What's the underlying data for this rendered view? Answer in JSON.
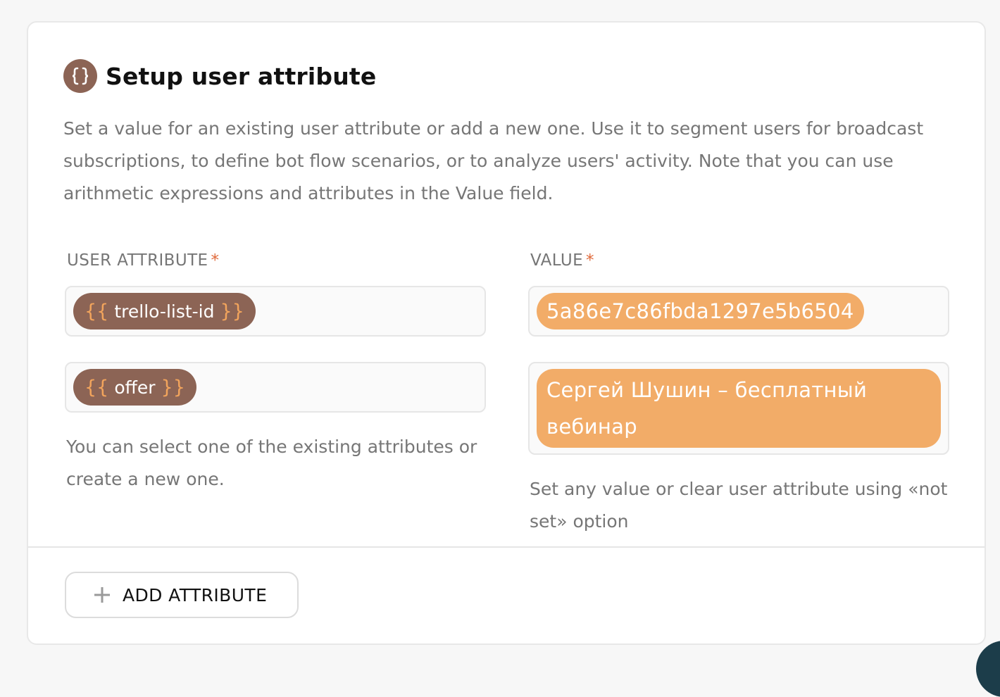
{
  "card": {
    "title": "Setup user attribute",
    "icon": "curly-braces-icon",
    "description": "Set a value for an existing user attribute or add a new one. Use it to segment users for broadcast subscriptions, to define bot flow scenarios, or to analyze users' activity. Note that you can use arithmetic expressions and attributes in the Value field."
  },
  "attribute_column": {
    "label": "USER ATTRIBUTE",
    "required_mark": "*",
    "brace_open": "{{",
    "brace_close": "}}",
    "items": [
      {
        "name": "trello-list-id"
      },
      {
        "name": "offer"
      }
    ],
    "help": "You can select one of the existing attributes or create a new one."
  },
  "value_column": {
    "label": "VALUE",
    "required_mark": "*",
    "items": [
      {
        "value": "5a86e7c86fbda1297e5b6504"
      },
      {
        "value": "Сергей Шушин – бесплатный вебинар"
      }
    ],
    "help": "Set any value or clear user attribute using «not set» option"
  },
  "add_button": {
    "label": "ADD ATTRIBUTE",
    "icon": "plus-icon"
  },
  "colors": {
    "attribute_chip": "#8c6455",
    "value_chip": "#f2ac68",
    "brace": "#f2a45c",
    "required": "#e0693a",
    "corner_button": "#1c3d4a"
  }
}
